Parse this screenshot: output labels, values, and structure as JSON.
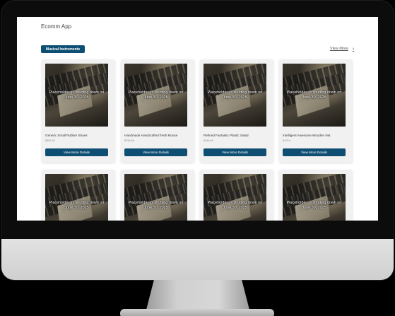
{
  "app": {
    "title": "Ecomm App"
  },
  "category": {
    "label": "Musical Instruments"
  },
  "view_more": {
    "label": "View More",
    "icon": "chevron-right-icon"
  },
  "theme": {
    "primary": "#0f4e73",
    "screen_bg": "#ffffff",
    "card_bg": "#f1f1f1"
  },
  "image_notice": "Placeholder: is shutting down on June 30, 2025",
  "products": [
    {
      "name": "Generic Small Rubber Shoes",
      "price": "$663.00",
      "button": "View More Details"
    },
    {
      "name": "Handmade Handcrafted fresh Mouse",
      "price": "$758.68",
      "button": "View More Details"
    },
    {
      "name": "Refined Fantastic Plastic Salad",
      "price": "$346.69",
      "button": "View More Details"
    },
    {
      "name": "Intelligent Awesome Wooden Hat",
      "price": "$479.4",
      "button": "View More Details"
    },
    {
      "name": "",
      "price": "",
      "button": ""
    },
    {
      "name": "",
      "price": "",
      "button": ""
    },
    {
      "name": "",
      "price": "",
      "button": ""
    },
    {
      "name": "",
      "price": "",
      "button": ""
    }
  ]
}
